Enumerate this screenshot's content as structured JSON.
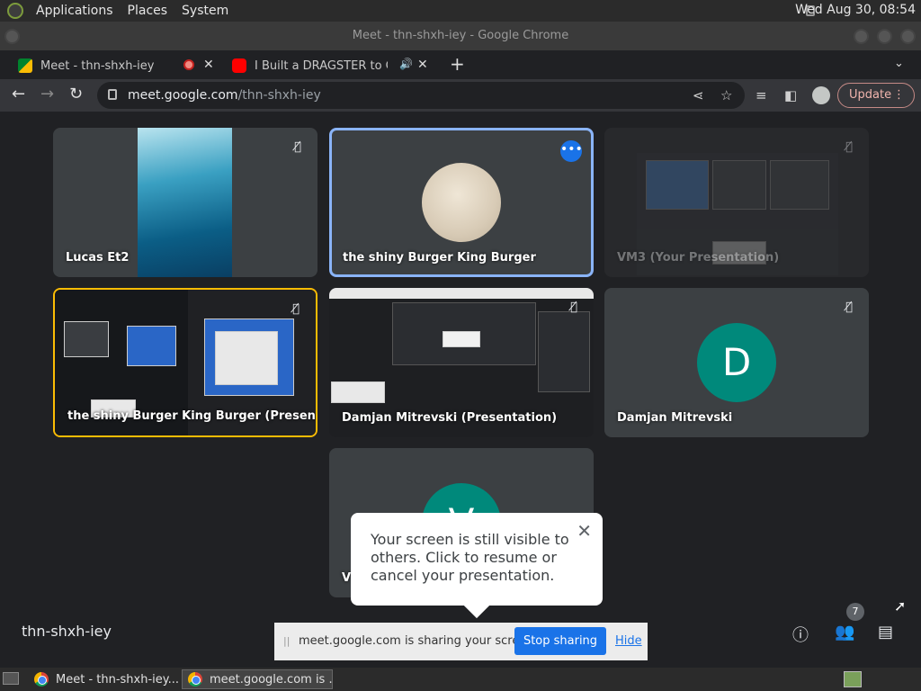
{
  "top_panel": {
    "menus": [
      "Applications",
      "Places",
      "System"
    ],
    "clock": "Wed Aug 30, 08:54"
  },
  "window": {
    "title": "Meet - thn-shxh-iey - Google Chrome"
  },
  "tabs": [
    {
      "title": "Meet - thn-shxh-iey",
      "active": true,
      "recording": true
    },
    {
      "title": "I Built a DRAGSTER to Get",
      "active": false,
      "audio": true
    }
  ],
  "toolbar": {
    "url_host": "meet.google.com",
    "url_path": "/thn-shxh-iey",
    "update_label": "Update"
  },
  "tiles": [
    {
      "name": "Lucas Et2",
      "muted": true,
      "kind": "video"
    },
    {
      "name": "the shiny Burger King Burger",
      "muted": false,
      "kind": "avatar",
      "highlighted": true
    },
    {
      "name": "VM3 (Your Presentation)",
      "muted": true,
      "kind": "presentation",
      "dimmed": true
    },
    {
      "name": "the shiny Burger King Burger (Presen...",
      "muted": true,
      "kind": "presentation"
    },
    {
      "name": "Damjan Mitrevski (Presentation)",
      "muted": true,
      "kind": "presentation"
    },
    {
      "name": "Damjan Mitrevski",
      "muted": true,
      "kind": "avatar",
      "initial": "D"
    },
    {
      "name": "V",
      "muted": false,
      "kind": "avatar",
      "initial": "V"
    }
  ],
  "popover": {
    "text": "Your screen is still visible to others. Click to resume or cancel your presentation."
  },
  "meeting_code": "thn-shxh-iey",
  "people_count": "7",
  "share_bar": {
    "message": "meet.google.com is sharing your screen.",
    "stop_label": "Stop sharing",
    "hide_label": "Hide"
  },
  "taskbar": {
    "items": [
      "Meet - thn-shxh-iey...",
      "meet.google.com is ..."
    ]
  },
  "colors": {
    "accent": "#1a73e8",
    "avatar_teal": "#00897b",
    "meet_bg": "#202124",
    "tile_bg": "#3c4043"
  }
}
